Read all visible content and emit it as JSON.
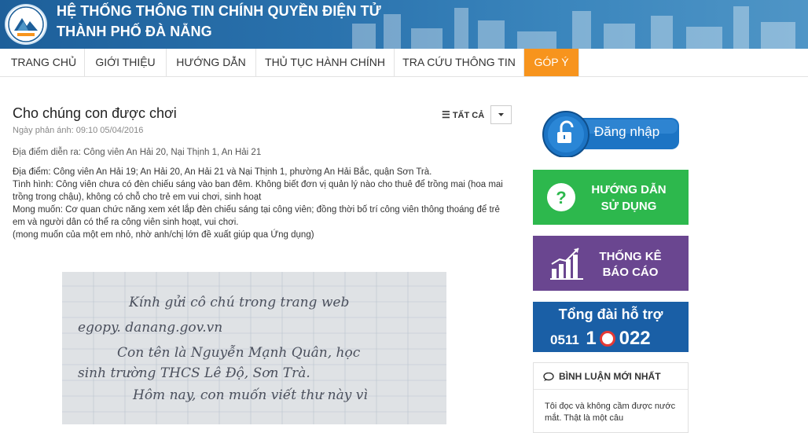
{
  "header": {
    "title_line1": "HỆ THỐNG THÔNG TIN CHÍNH QUYỀN ĐIỆN TỬ",
    "title_line2": "THÀNH PHỐ ĐÀ NẴNG",
    "logo_icon": "danang-logo-icon"
  },
  "nav": {
    "items": [
      {
        "label": "TRANG CHỦ"
      },
      {
        "label": "GIỚI THIỆU"
      },
      {
        "label": "HƯỚNG DẪN"
      },
      {
        "label": "THỦ TỤC HÀNH CHÍNH"
      },
      {
        "label": "TRA CỨU THÔNG TIN"
      },
      {
        "label": "GÓP Ý"
      }
    ],
    "active_index": 5,
    "active_color": "#f7941d"
  },
  "post": {
    "title": "Cho chúng con được chơi",
    "date": "Ngày phản ánh: 09:10 05/04/2016",
    "location": "Địa điểm diễn ra: Công viên An Hải 20, Nại Thịnh 1, An Hải 21",
    "lines": [
      "Địa điểm: Công viên An Hải 19; An Hải 20, An Hải 21 và Nại Thịnh 1, phường An Hải Bắc, quận Sơn Trà.",
      "Tình hình: Công viên chưa có đèn chiếu sáng vào ban đêm. Không biết đơn vị quản lý nào cho thuê để trồng mai (hoa mai trồng trong chậu), không có chỗ cho trẻ em vui chơi, sinh hoạt",
      "Mong muốn: Cơ quan chức năng xem xét lắp đèn chiếu sáng tại công viên; đồng thời bố trí công viên thông thoáng để trẻ em và người dân có thể ra công viên sinh hoạt, vui chơi.",
      "(mong muốn của một em nhỏ, nhờ anh/chị lớn đề xuất giúp qua Ứng dụng)"
    ],
    "filter_label": "TẤT CẢ",
    "letter_lines": [
      "Kính gửi cô chú trong trang web",
      "egopy. danang.gov.vn",
      "Con tên là Nguyễn Mạnh Quân, học",
      "sinh trường THCS Lê Độ, Sơn Trà.",
      "Hôm nay, con muốn viết thư này vì"
    ]
  },
  "sidebar": {
    "login_label": "Đăng nhập",
    "help_label_1": "HƯỚNG DẪN",
    "help_label_2": "SỬ DỤNG",
    "stats_label_1": "THỐNG KÊ",
    "stats_label_2": "BÁO CÁO",
    "hotline_title": "Tổng đài hỗ trợ",
    "hotline_prefix": "0511",
    "hotline_number_a": "1",
    "hotline_number_b": "022",
    "comments_title": "BÌNH LUẬN MỚI NHẤT",
    "comment_text": "Tôi đọc và không cầm được nước mắt. Thật là một câu",
    "colors": {
      "help": "#2db84d",
      "stats": "#6a4690",
      "hotline": "#1a5fa6",
      "login": "#1c74c4"
    }
  }
}
